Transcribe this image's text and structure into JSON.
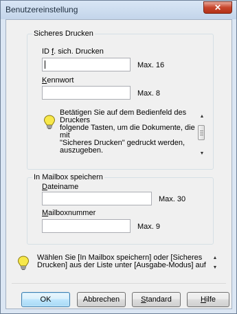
{
  "window": {
    "title": "Benutzereinstellung",
    "close_glyph": "✕"
  },
  "secure_print": {
    "group_title": "Sicheres Drucken",
    "id_label_pre": "ID ",
    "id_label_u": "f",
    "id_label_post": ". sich. Drucken",
    "id_value": "",
    "id_max": "Max. 16",
    "password_label_u": "K",
    "password_label_rest": "ennwort",
    "password_value": "",
    "password_max": "Max. 8",
    "hint": "Betätigen Sie auf dem Bedienfeld des Druckers\nfolgende Tasten, um die Dokumente, die mit\n\"Sicheres Drucken\" gedruckt werden,\nauszugeben."
  },
  "mailbox": {
    "group_title": "In Mailbox speichern",
    "filename_label_u": "D",
    "filename_label_rest": "ateiname",
    "filename_value": "",
    "filename_max": "Max. 30",
    "number_label_u": "M",
    "number_label_rest": "ailboxnummer",
    "number_value": "",
    "number_max": "Max. 9"
  },
  "bottom_hint": "Wählen Sie [In Mailbox speichern] oder [Sicheres\nDrucken] aus der Liste unter [Ausgabe-Modus] auf",
  "buttons": {
    "ok": "OK",
    "cancel": "Abbrechen",
    "standard_u": "S",
    "standard_rest": "tandard",
    "help_u": "H",
    "help_rest": "ilfe"
  },
  "icons": {
    "lightbulb": "lightbulb-icon",
    "close": "close-icon",
    "scroll_up": "▲",
    "scroll_down": "▼"
  },
  "colors": {
    "title_bar": "#c3d5ea",
    "close_button": "#c7452c",
    "default_button_border": "#3c7fb1",
    "bulb": "#f7e84a"
  }
}
